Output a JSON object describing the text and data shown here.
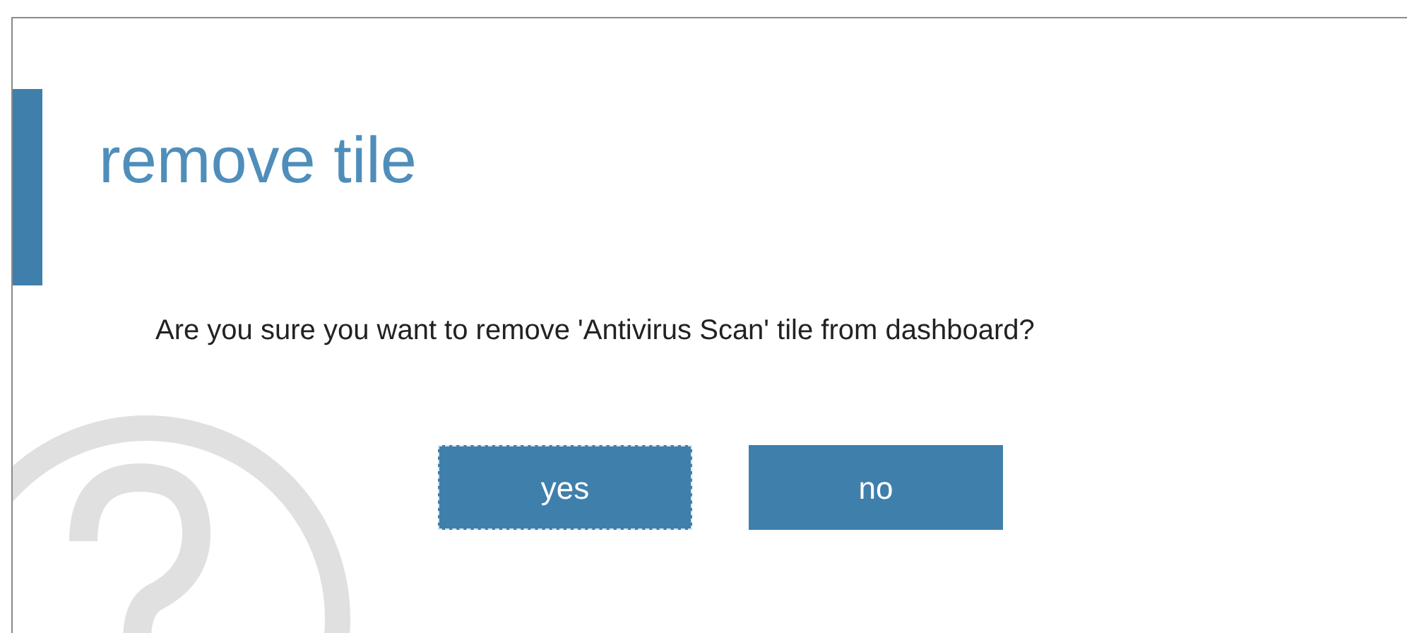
{
  "dialog": {
    "title": "remove tile",
    "message": "Are you sure you want to remove 'Antivirus Scan' tile from dashboard?"
  },
  "buttons": [
    {
      "label": "yes",
      "focused": true
    },
    {
      "label": "no",
      "focused": false
    }
  ]
}
